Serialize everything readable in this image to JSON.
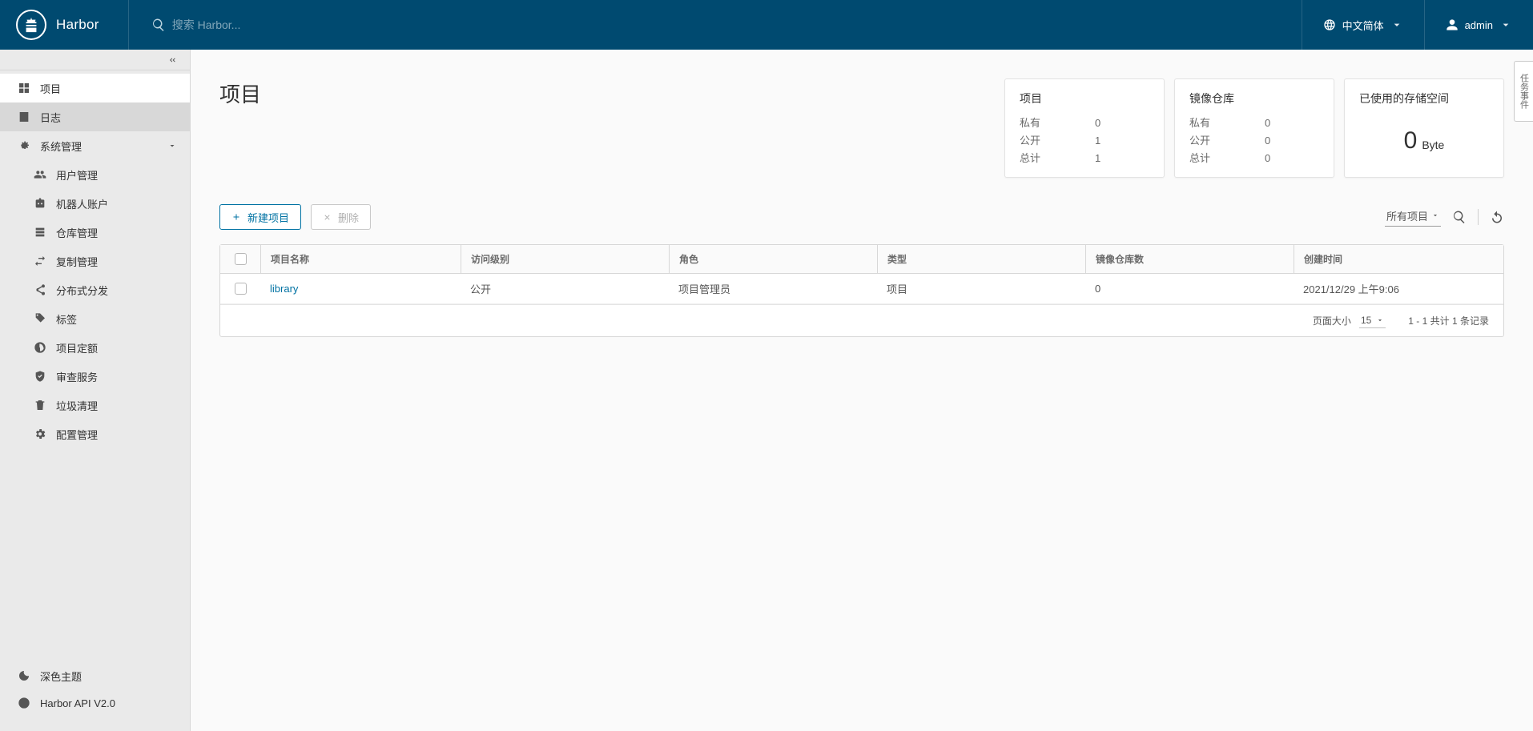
{
  "brand": "Harbor",
  "search": {
    "placeholder": "搜索 Harbor..."
  },
  "lang": "中文简体",
  "user": "admin",
  "sidebar": {
    "items": [
      {
        "label": "项目"
      },
      {
        "label": "日志"
      },
      {
        "label": "系统管理"
      }
    ],
    "admin_children": [
      {
        "label": "用户管理"
      },
      {
        "label": "机器人账户"
      },
      {
        "label": "仓库管理"
      },
      {
        "label": "复制管理"
      },
      {
        "label": "分布式分发"
      },
      {
        "label": "标签"
      },
      {
        "label": "项目定额"
      },
      {
        "label": "审查服务"
      },
      {
        "label": "垃圾清理"
      },
      {
        "label": "配置管理"
      }
    ],
    "bottom": [
      {
        "label": "深色主题"
      },
      {
        "label": "Harbor API V2.0"
      }
    ]
  },
  "page": {
    "title": "项目"
  },
  "summary": {
    "projects": {
      "title": "项目",
      "private_label": "私有",
      "private": "0",
      "public_label": "公开",
      "public": "1",
      "total_label": "总计",
      "total": "1"
    },
    "repos": {
      "title": "镜像仓库",
      "private_label": "私有",
      "private": "0",
      "public_label": "公开",
      "public": "0",
      "total_label": "总计",
      "total": "0"
    },
    "storage": {
      "title": "已使用的存储空间",
      "value": "0",
      "unit": "Byte"
    }
  },
  "toolbar": {
    "new_project": "新建项目",
    "delete": "删除",
    "filter": "所有项目"
  },
  "table": {
    "headers": {
      "name": "项目名称",
      "access": "访问级别",
      "role": "角色",
      "type": "类型",
      "repo": "镜像仓库数",
      "created": "创建时间"
    },
    "rows": [
      {
        "name": "library",
        "access": "公开",
        "role": "项目管理员",
        "type": "项目",
        "repo": "0",
        "created": "2021/12/29 上午9:06"
      }
    ],
    "footer": {
      "page_size_label": "页面大小",
      "page_size": "15",
      "range": "1 - 1 共计 1 条记录"
    }
  },
  "side_tab": "任务事件"
}
